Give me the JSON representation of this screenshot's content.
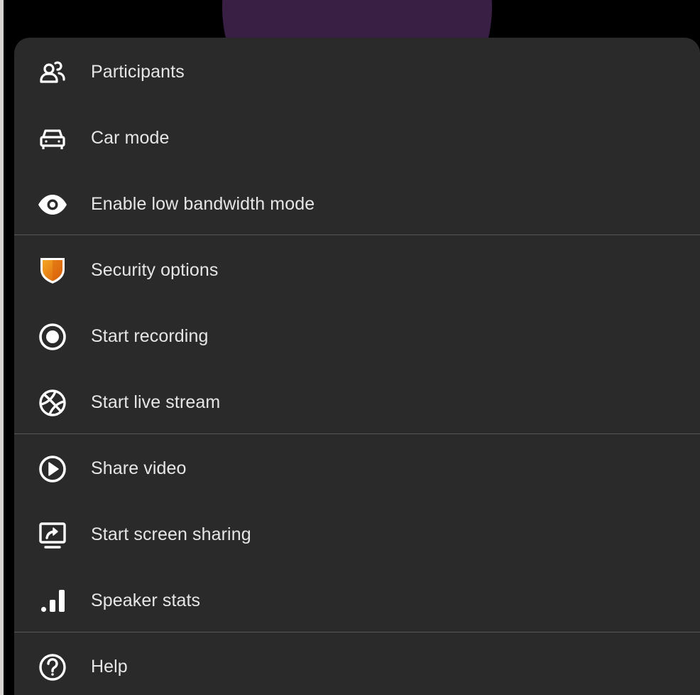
{
  "menu": {
    "items": [
      {
        "label": "Participants",
        "icon": "participants-icon"
      },
      {
        "label": "Car mode",
        "icon": "car-icon"
      },
      {
        "label": "Enable low bandwidth mode",
        "icon": "eye-icon"
      },
      {
        "label": "Security options",
        "icon": "shield-icon"
      },
      {
        "label": "Start recording",
        "icon": "record-icon"
      },
      {
        "label": "Start live stream",
        "icon": "globe-icon"
      },
      {
        "label": "Share video",
        "icon": "play-circle-icon"
      },
      {
        "label": "Start screen sharing",
        "icon": "screen-share-icon"
      },
      {
        "label": "Speaker stats",
        "icon": "bar-chart-icon"
      },
      {
        "label": "Help",
        "icon": "help-icon"
      }
    ]
  },
  "colors": {
    "background": "#000000",
    "sheet": "#2a2a2a",
    "text": "#e6e6e6",
    "divider": "#575757",
    "avatar": "#3a1f45",
    "shield_top": "#f5a623",
    "shield_bottom": "#d9600b"
  }
}
